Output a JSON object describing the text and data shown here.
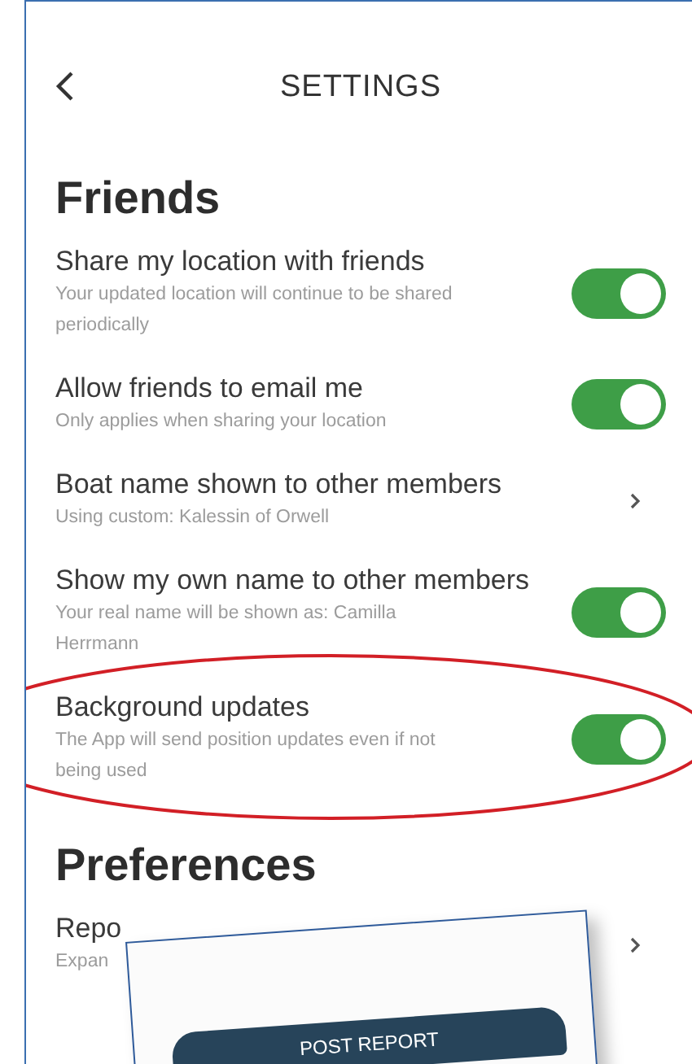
{
  "header": {
    "title": "SETTINGS"
  },
  "sections": [
    {
      "heading": "Friends",
      "rows": [
        {
          "kind": "toggle",
          "title": "Share my location with friends",
          "subtitle": "Your updated location will continue to be shared periodically",
          "on": true,
          "circled": false
        },
        {
          "kind": "toggle",
          "title": "Allow friends to email me",
          "subtitle": "Only applies when sharing your location",
          "on": true,
          "circled": false
        },
        {
          "kind": "link",
          "title": "Boat name shown to other members",
          "subtitle": "Using custom: Kalessin of Orwell",
          "circled": false
        },
        {
          "kind": "toggle",
          "title": "Show my own name to other members",
          "subtitle": "Your real name will be shown as: Camilla Herrmann",
          "on": true,
          "circled": false
        },
        {
          "kind": "toggle",
          "title": "Background updates",
          "subtitle": "The App will send position updates even if not being used",
          "on": true,
          "circled": true
        }
      ]
    },
    {
      "heading": "Preferences",
      "rows": [
        {
          "kind": "link",
          "title": "Repo",
          "subtitle": "Expan",
          "circled": false
        }
      ]
    }
  ],
  "overlay_card": {
    "button": "POST REPORT"
  }
}
